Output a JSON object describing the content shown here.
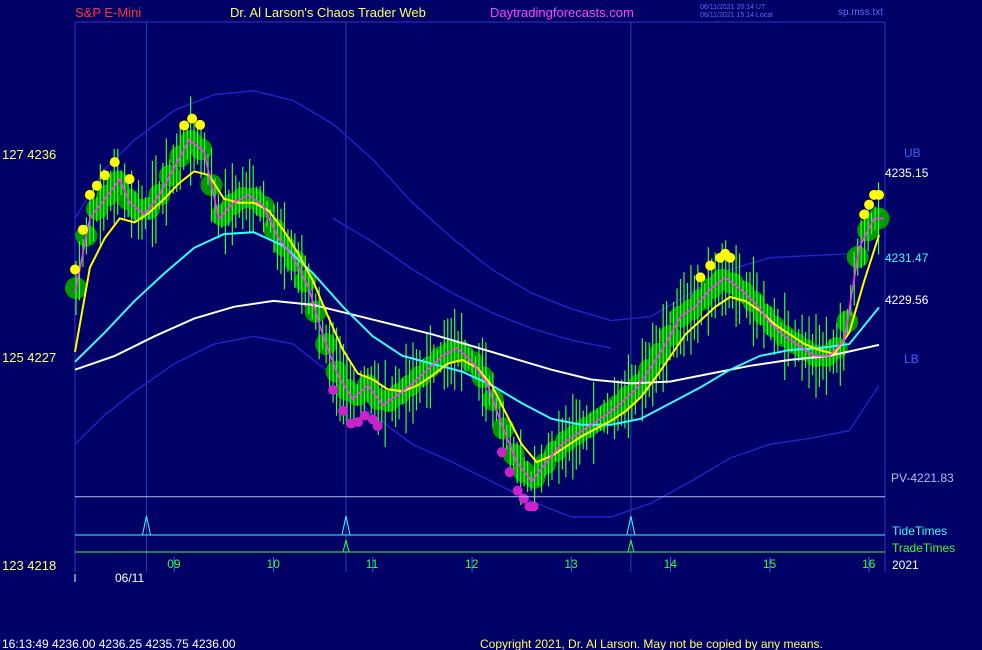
{
  "header": {
    "symbol": "S&P E-Mini",
    "site": "Dr. Al Larson's Chaos Trader Web",
    "url": "Daytradingforecasts.com",
    "stamp_ut": "06/11/2021 20:14 UT",
    "stamp_local": "06/11/2021 15:14 Local",
    "file": "sp.mss.txt"
  },
  "colors": {
    "background": "#000066",
    "frame": "#3333cc",
    "symbol_text": "#ff3333",
    "site_text": "#ffff66",
    "url_text": "#ff44ff",
    "price_ema": "#ffff00",
    "fast_line": "#ff33ff",
    "cyan_ma": "#33ffff",
    "white_ma": "#ffffff",
    "band": "#2222cc",
    "bubble_green": "#009900",
    "bars": "#33ff33",
    "tide": "#33ffff",
    "trade": "#33ff33"
  },
  "y_axis": {
    "labels": [
      {
        "text": "127  4236",
        "price": 4236
      },
      {
        "text": "125  4227",
        "price": 4227
      },
      {
        "text": "123  4218",
        "price": 4218
      }
    ]
  },
  "x_axis": {
    "date_label": "06/11",
    "hours": [
      "09",
      "10",
      "11",
      "12",
      "13",
      "14",
      "15",
      "16"
    ],
    "year": "2021"
  },
  "right_labels": {
    "ub": "UB",
    "lb": "LB",
    "ema": "4235.15",
    "cyan": "4231.47",
    "white": "4229.56",
    "pivot": "PV-4221.83",
    "tide": "TideTimes",
    "trade": "TradeTimes"
  },
  "footer": {
    "quote": "16:13:49  4236.00  4236.25  4235.75  4236.00",
    "copyright": "Copyright 2021, Dr. Al Larson. May not be copied by any means."
  },
  "chart_data": {
    "type": "line",
    "x_unit": "hour of day",
    "xlim": [
      8.0,
      16.15
    ],
    "ylim": [
      4218,
      4246
    ],
    "pivot": 4221.83,
    "event_times": {
      "tide": [
        8.72,
        10.73,
        13.6
      ],
      "trade": [
        10.73,
        13.6
      ]
    },
    "series": [
      {
        "key": "price",
        "points": [
          [
            8.0,
            4232.2
          ],
          [
            8.15,
            4236.0
          ],
          [
            8.3,
            4237.0
          ],
          [
            8.45,
            4238.0
          ],
          [
            8.55,
            4236.8
          ],
          [
            8.7,
            4236.2
          ],
          [
            8.85,
            4237.2
          ],
          [
            9.0,
            4238.6
          ],
          [
            9.15,
            4240.0
          ],
          [
            9.3,
            4239.4
          ],
          [
            9.45,
            4236.0
          ],
          [
            9.6,
            4236.8
          ],
          [
            9.75,
            4237.2
          ],
          [
            9.9,
            4236.6
          ],
          [
            10.05,
            4235.0
          ],
          [
            10.2,
            4234.0
          ],
          [
            10.35,
            4232.5
          ],
          [
            10.5,
            4230.0
          ],
          [
            10.65,
            4228.0
          ],
          [
            10.8,
            4226.8
          ],
          [
            10.95,
            4227.5
          ],
          [
            11.1,
            4226.5
          ],
          [
            11.25,
            4227.0
          ],
          [
            11.4,
            4227.6
          ],
          [
            11.55,
            4228.3
          ],
          [
            11.7,
            4229.0
          ],
          [
            11.85,
            4229.4
          ],
          [
            12.0,
            4228.7
          ],
          [
            12.15,
            4227.6
          ],
          [
            12.3,
            4225.5
          ],
          [
            12.45,
            4223.6
          ],
          [
            12.6,
            4222.6
          ],
          [
            12.75,
            4223.6
          ],
          [
            12.9,
            4224.5
          ],
          [
            13.05,
            4225.0
          ],
          [
            13.2,
            4225.5
          ],
          [
            13.35,
            4226.0
          ],
          [
            13.5,
            4226.6
          ],
          [
            13.65,
            4227.3
          ],
          [
            13.8,
            4228.4
          ],
          [
            13.95,
            4229.6
          ],
          [
            14.1,
            4231.0
          ],
          [
            14.25,
            4231.5
          ],
          [
            14.4,
            4232.4
          ],
          [
            14.55,
            4233.0
          ],
          [
            14.7,
            4232.4
          ],
          [
            14.85,
            4231.7
          ],
          [
            15.0,
            4230.7
          ],
          [
            15.15,
            4230.0
          ],
          [
            15.3,
            4229.5
          ],
          [
            15.45,
            4229.0
          ],
          [
            15.6,
            4229.0
          ],
          [
            15.75,
            4229.8
          ],
          [
            15.9,
            4234.5
          ],
          [
            16.05,
            4236.0
          ],
          [
            16.15,
            4236.0
          ]
        ]
      },
      {
        "key": "ema",
        "points": [
          [
            8.0,
            4229.2
          ],
          [
            8.15,
            4233.5
          ],
          [
            8.3,
            4235.0
          ],
          [
            8.45,
            4236.0
          ],
          [
            8.6,
            4235.8
          ],
          [
            8.75,
            4236.3
          ],
          [
            8.9,
            4237.0
          ],
          [
            9.05,
            4237.8
          ],
          [
            9.2,
            4238.4
          ],
          [
            9.35,
            4238.2
          ],
          [
            9.5,
            4237.0
          ],
          [
            9.65,
            4236.8
          ],
          [
            9.8,
            4236.8
          ],
          [
            9.95,
            4236.4
          ],
          [
            10.1,
            4235.4
          ],
          [
            10.25,
            4234.2
          ],
          [
            10.4,
            4232.8
          ],
          [
            10.55,
            4231.0
          ],
          [
            10.7,
            4229.3
          ],
          [
            10.85,
            4228.1
          ],
          [
            11.0,
            4227.8
          ],
          [
            11.15,
            4227.3
          ],
          [
            11.3,
            4227.2
          ],
          [
            11.45,
            4227.5
          ],
          [
            11.6,
            4228.0
          ],
          [
            11.75,
            4228.6
          ],
          [
            11.9,
            4228.8
          ],
          [
            12.05,
            4228.4
          ],
          [
            12.2,
            4227.5
          ],
          [
            12.35,
            4226.0
          ],
          [
            12.5,
            4224.5
          ],
          [
            12.65,
            4223.6
          ],
          [
            12.8,
            4223.9
          ],
          [
            12.95,
            4224.4
          ],
          [
            13.1,
            4224.9
          ],
          [
            13.25,
            4225.3
          ],
          [
            13.4,
            4225.7
          ],
          [
            13.55,
            4226.2
          ],
          [
            13.7,
            4226.9
          ],
          [
            13.85,
            4227.9
          ],
          [
            14.0,
            4229.0
          ],
          [
            14.15,
            4230.1
          ],
          [
            14.3,
            4230.8
          ],
          [
            14.45,
            4231.5
          ],
          [
            14.6,
            4232.0
          ],
          [
            14.75,
            4231.8
          ],
          [
            14.9,
            4231.3
          ],
          [
            15.05,
            4230.6
          ],
          [
            15.2,
            4230.1
          ],
          [
            15.35,
            4229.6
          ],
          [
            15.5,
            4229.3
          ],
          [
            15.65,
            4229.1
          ],
          [
            15.8,
            4230.2
          ],
          [
            15.95,
            4232.8
          ],
          [
            16.1,
            4235.15
          ]
        ]
      },
      {
        "key": "cyan_ma",
        "points": [
          [
            8.0,
            4228.7
          ],
          [
            8.3,
            4230.2
          ],
          [
            8.6,
            4231.8
          ],
          [
            8.9,
            4233.2
          ],
          [
            9.2,
            4234.5
          ],
          [
            9.5,
            4235.2
          ],
          [
            9.8,
            4235.3
          ],
          [
            10.1,
            4234.6
          ],
          [
            10.4,
            4233.2
          ],
          [
            10.7,
            4231.5
          ],
          [
            11.0,
            4230.0
          ],
          [
            11.3,
            4229.0
          ],
          [
            11.6,
            4228.6
          ],
          [
            11.9,
            4228.2
          ],
          [
            12.2,
            4227.5
          ],
          [
            12.5,
            4226.6
          ],
          [
            12.8,
            4225.8
          ],
          [
            13.1,
            4225.5
          ],
          [
            13.4,
            4225.5
          ],
          [
            13.7,
            4225.8
          ],
          [
            14.0,
            4226.6
          ],
          [
            14.3,
            4227.4
          ],
          [
            14.6,
            4228.3
          ],
          [
            14.9,
            4229.0
          ],
          [
            15.2,
            4229.3
          ],
          [
            15.5,
            4229.4
          ],
          [
            15.8,
            4229.6
          ],
          [
            16.1,
            4231.47
          ]
        ]
      },
      {
        "key": "white_ma",
        "points": [
          [
            8.0,
            4228.3
          ],
          [
            8.4,
            4229.0
          ],
          [
            8.8,
            4230.0
          ],
          [
            9.2,
            4230.9
          ],
          [
            9.6,
            4231.5
          ],
          [
            10.0,
            4231.8
          ],
          [
            10.4,
            4231.6
          ],
          [
            10.8,
            4231.1
          ],
          [
            11.2,
            4230.6
          ],
          [
            11.6,
            4230.1
          ],
          [
            12.0,
            4229.5
          ],
          [
            12.4,
            4228.9
          ],
          [
            12.8,
            4228.3
          ],
          [
            13.2,
            4227.8
          ],
          [
            13.6,
            4227.6
          ],
          [
            14.0,
            4227.7
          ],
          [
            14.4,
            4228.1
          ],
          [
            14.8,
            4228.5
          ],
          [
            15.2,
            4228.8
          ],
          [
            15.6,
            4229.0
          ],
          [
            16.1,
            4229.56
          ]
        ]
      },
      {
        "key": "upper_band",
        "points": [
          [
            8.0,
            4236.0
          ],
          [
            8.3,
            4238.5
          ],
          [
            8.6,
            4240.0
          ],
          [
            9.0,
            4241.5
          ],
          [
            9.4,
            4242.3
          ],
          [
            9.8,
            4242.5
          ],
          [
            10.2,
            4242.0
          ],
          [
            10.6,
            4240.8
          ],
          [
            11.0,
            4239.0
          ],
          [
            11.4,
            4236.8
          ],
          [
            11.8,
            4235.0
          ],
          [
            12.2,
            4233.4
          ],
          [
            12.6,
            4232.2
          ],
          [
            13.0,
            4231.4
          ],
          [
            13.4,
            4230.8
          ],
          [
            13.8,
            4231.0
          ],
          [
            14.2,
            4232.2
          ],
          [
            14.6,
            4233.4
          ],
          [
            15.0,
            4234.0
          ],
          [
            15.4,
            4234.1
          ],
          [
            15.8,
            4234.2
          ],
          [
            16.1,
            4236.0
          ]
        ]
      },
      {
        "key": "upper_inner_band",
        "points": [
          [
            10.6,
            4236.0
          ],
          [
            11.0,
            4234.8
          ],
          [
            11.4,
            4233.4
          ],
          [
            11.8,
            4232.2
          ],
          [
            12.2,
            4231.2
          ],
          [
            12.6,
            4230.4
          ],
          [
            13.0,
            4229.8
          ],
          [
            13.4,
            4229.4
          ]
        ]
      },
      {
        "key": "lower_band",
        "points": [
          [
            8.0,
            4224.5
          ],
          [
            8.3,
            4226.0
          ],
          [
            8.6,
            4227.2
          ],
          [
            9.0,
            4228.6
          ],
          [
            9.4,
            4229.6
          ],
          [
            9.8,
            4230.0
          ],
          [
            10.2,
            4229.6
          ],
          [
            10.6,
            4228.0
          ],
          [
            11.0,
            4226.0
          ],
          [
            11.4,
            4224.5
          ],
          [
            11.8,
            4223.6
          ],
          [
            12.2,
            4222.6
          ],
          [
            12.6,
            4221.6
          ],
          [
            13.0,
            4220.8
          ],
          [
            13.4,
            4220.8
          ],
          [
            13.8,
            4221.5
          ],
          [
            14.2,
            4222.6
          ],
          [
            14.6,
            4223.8
          ],
          [
            15.0,
            4224.5
          ],
          [
            15.4,
            4224.8
          ],
          [
            15.8,
            4225.2
          ],
          [
            16.1,
            4227.5
          ]
        ]
      }
    ]
  }
}
